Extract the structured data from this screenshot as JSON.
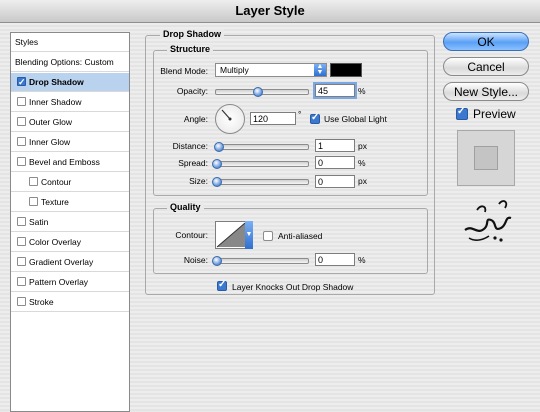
{
  "window": {
    "title": "Layer Style"
  },
  "sidebar": {
    "header": "Styles",
    "items": [
      {
        "label": "Blending Options: Custom",
        "checkbox": false,
        "checked": false,
        "selected": false
      },
      {
        "label": "Drop Shadow",
        "checkbox": true,
        "checked": true,
        "selected": true
      },
      {
        "label": "Inner Shadow",
        "checkbox": true,
        "checked": false,
        "selected": false
      },
      {
        "label": "Outer Glow",
        "checkbox": true,
        "checked": false,
        "selected": false
      },
      {
        "label": "Inner Glow",
        "checkbox": true,
        "checked": false,
        "selected": false
      },
      {
        "label": "Bevel and Emboss",
        "checkbox": true,
        "checked": false,
        "selected": false
      },
      {
        "label": "Contour",
        "checkbox": true,
        "checked": false,
        "selected": false,
        "indent": true
      },
      {
        "label": "Texture",
        "checkbox": true,
        "checked": false,
        "selected": false,
        "indent": true
      },
      {
        "label": "Satin",
        "checkbox": true,
        "checked": false,
        "selected": false
      },
      {
        "label": "Color Overlay",
        "checkbox": true,
        "checked": false,
        "selected": false
      },
      {
        "label": "Gradient Overlay",
        "checkbox": true,
        "checked": false,
        "selected": false
      },
      {
        "label": "Pattern Overlay",
        "checkbox": true,
        "checked": false,
        "selected": false
      },
      {
        "label": "Stroke",
        "checkbox": true,
        "checked": false,
        "selected": false
      }
    ]
  },
  "panel": {
    "title": "Drop Shadow",
    "structure": {
      "title": "Structure",
      "blend_mode_label": "Blend Mode:",
      "blend_mode_value": "Multiply",
      "shadow_color": "#000000",
      "opacity_label": "Opacity:",
      "opacity_value": "45",
      "opacity_unit": "%",
      "opacity_fraction": 0.45,
      "angle_label": "Angle:",
      "angle_value": "120",
      "angle_unit": "°",
      "global_light_label": "Use Global Light",
      "global_light_checked": true,
      "distance_label": "Distance:",
      "distance_value": "1",
      "distance_unit": "px",
      "spread_label": "Spread:",
      "spread_value": "0",
      "spread_unit": "%",
      "size_label": "Size:",
      "size_value": "0",
      "size_unit": "px"
    },
    "quality": {
      "title": "Quality",
      "contour_label": "Contour:",
      "anti_aliased_label": "Anti-aliased",
      "anti_aliased_checked": false,
      "noise_label": "Noise:",
      "noise_value": "0",
      "noise_unit": "%"
    },
    "knockout_label": "Layer Knocks Out Drop Shadow",
    "knockout_checked": true
  },
  "buttons": {
    "ok": "OK",
    "cancel": "Cancel",
    "new_style": "New Style...",
    "preview_label": "Preview",
    "preview_checked": true
  },
  "colors": {
    "accent": "#3b78d0",
    "selection": "#b9d2ee"
  }
}
